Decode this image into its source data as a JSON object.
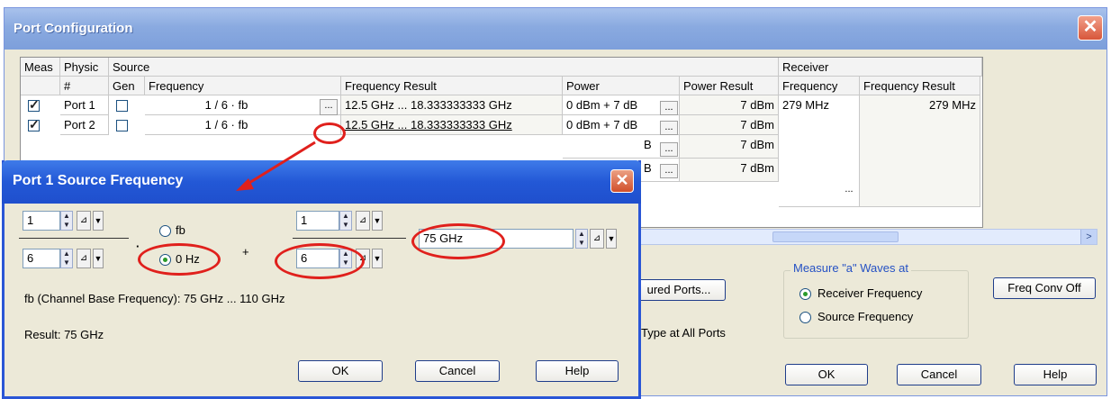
{
  "window": {
    "title": "Port Configuration"
  },
  "grid": {
    "group_headers": {
      "meas": "Meas",
      "physical": "Physic",
      "source": "Source",
      "receiver": "Receiver"
    },
    "columns": {
      "port_num": "#",
      "gen": "Gen",
      "frequency": "Frequency",
      "frequency_result": "Frequency Result",
      "power": "Power",
      "power_result": "Power Result",
      "rx_frequency": "Frequency",
      "rx_frequency_result": "Frequency Result"
    },
    "rows": [
      {
        "measured": true,
        "port": "Port 1",
        "gen": false,
        "frequency": "1 / 6 · fb",
        "frequency_result": "12.5 GHz ... 18.333333333 GHz",
        "power": "0 dBm + 7 dB",
        "power_result": "7 dBm"
      },
      {
        "measured": true,
        "port": "Port 2",
        "gen": false,
        "frequency": "1 / 6 · fb",
        "frequency_result": "12.5 GHz ... 18.333333333 GHz",
        "power": "0 dBm + 7 dB",
        "power_result": "7 dBm"
      },
      {
        "power_fragment": "B",
        "power_result": "7 dBm"
      },
      {
        "power_fragment": "B",
        "power_result": "7 dBm"
      }
    ],
    "receiver": {
      "frequency": "279 MHz",
      "frequency_result": "279 MHz"
    },
    "ellipsis": "..."
  },
  "outer": {
    "configured_ports_button": "ured Ports...",
    "type_all_ports": "Type at All Ports",
    "measure_group": {
      "title": "Measure \"a\" Waves at",
      "options": [
        "Receiver Frequency",
        "Source Frequency"
      ],
      "selected": "Receiver Frequency"
    },
    "freq_conv_button": "Freq Conv Off",
    "ok": "OK",
    "cancel": "Cancel",
    "help": "Help"
  },
  "dialog": {
    "title": "Port 1 Source Frequency",
    "numerator_1": "1",
    "denominator_1": "6",
    "radio_fb": "fb",
    "radio_0hz": "0 Hz",
    "selected": "0 Hz",
    "multiply": "·",
    "plus": "+",
    "numerator_2": "1",
    "denominator_2": "6",
    "offset_value": "75 GHz",
    "base_frequency": "fb (Channel Base Frequency): 75 GHz ... 110 GHz",
    "result": "Result: 75 GHz",
    "ok": "OK",
    "cancel": "Cancel",
    "help": "Help"
  },
  "colors": {
    "annotation": "#e0201c",
    "title_active": "#2358d6",
    "title_inactive": "#8aaae0"
  }
}
